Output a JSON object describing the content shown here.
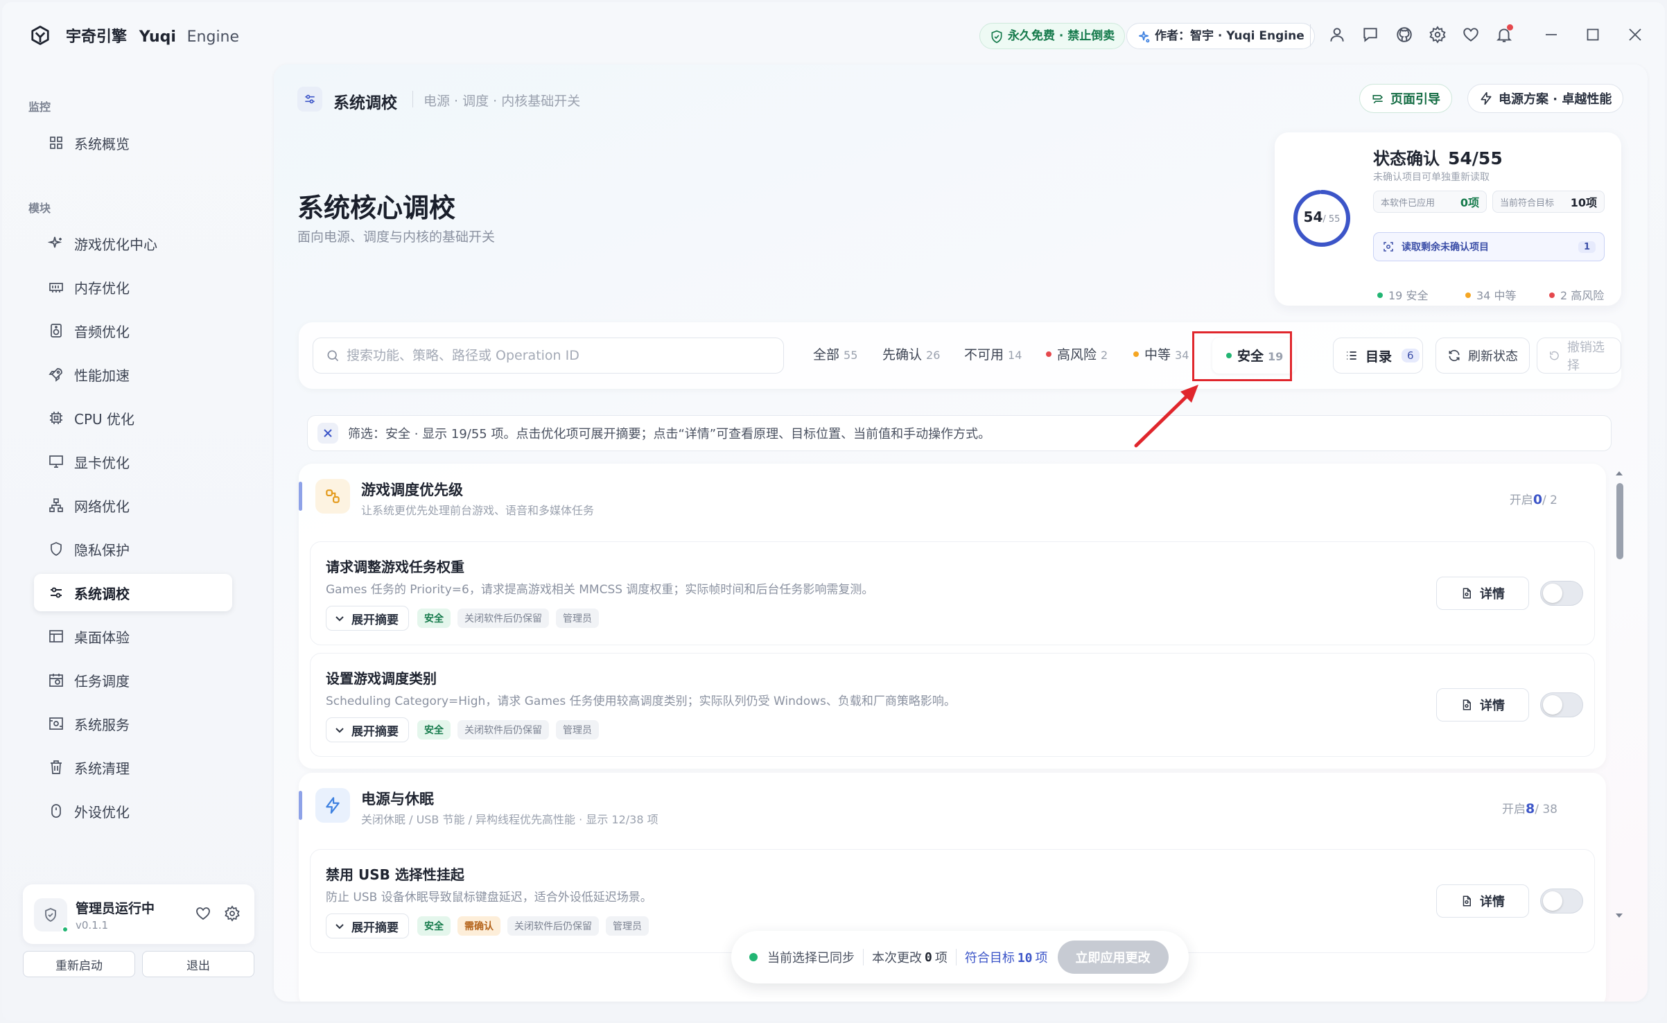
{
  "app": {
    "name": "宇奇引擎",
    "name_en": "Yuqi",
    "name_en2": "Engine"
  },
  "titlebar": {
    "badge_free": "永久免费 · 禁止倒卖",
    "badge_author": "作者：智宇 · Yuqi Engine",
    "icons": [
      "user-icon",
      "chat-icon",
      "github-icon",
      "gear-icon",
      "heart-icon",
      "bell-icon"
    ]
  },
  "sidebar": {
    "section_monitor": "监控",
    "section_modules": "模块",
    "items": [
      {
        "label": "系统概览",
        "icon": "grid-icon"
      },
      {
        "label": "游戏优化中心",
        "icon": "sparkle-icon"
      },
      {
        "label": "内存优化",
        "icon": "memory-icon"
      },
      {
        "label": "音频优化",
        "icon": "speaker-icon"
      },
      {
        "label": "性能加速",
        "icon": "rocket-icon"
      },
      {
        "label": "CPU 优化",
        "icon": "cpu-icon"
      },
      {
        "label": "显卡优化",
        "icon": "monitor-icon"
      },
      {
        "label": "网络优化",
        "icon": "network-icon"
      },
      {
        "label": "隐私保护",
        "icon": "shield-icon"
      },
      {
        "label": "系统调校",
        "icon": "sliders-icon"
      },
      {
        "label": "桌面体验",
        "icon": "layout-icon"
      },
      {
        "label": "任务调度",
        "icon": "calendar-icon"
      },
      {
        "label": "系统服务",
        "icon": "service-icon"
      },
      {
        "label": "系统清理",
        "icon": "trash-icon"
      },
      {
        "label": "外设优化",
        "icon": "mouse-icon"
      }
    ],
    "admin": {
      "title": "管理员运行中",
      "version": "v0.1.1"
    },
    "restart_label": "重新启动",
    "exit_label": "退出"
  },
  "page": {
    "crumb_title": "系统调校",
    "crumb_sub": "电源 · 调度 · 内核基础开关",
    "guide_label": "页面引导",
    "power_label": "电源方案 · 卓越性能",
    "hero_title": "系统核心调校",
    "hero_sub": "面向电源、调度与内核的基础开关"
  },
  "status": {
    "title": "状态确认",
    "confirmed": 54,
    "total": 55,
    "progress_text": "54/55",
    "ring_value": "54",
    "ring_total": "/ 55",
    "hint": "未确认项目可单独重新读取",
    "applied_label": "本软件已应用",
    "applied_value": "0项",
    "target_label": "当前符合目标",
    "target_value": "10项",
    "read_label": "读取剩余未确认项目",
    "read_count": "1",
    "legend_safe": "19 安全",
    "legend_medium": "34 中等",
    "legend_high": "2 高风险",
    "colors": {
      "safe": "#22b573",
      "medium": "#f5a623",
      "high": "#e5484d",
      "ring": "#3c55c8"
    }
  },
  "filter": {
    "search_placeholder": "搜索功能、策略、路径或 Operation ID",
    "tabs": [
      {
        "label": "全部",
        "count": "55"
      },
      {
        "label": "先确认",
        "count": "26"
      },
      {
        "label": "不可用",
        "count": "14"
      },
      {
        "label": "高风险",
        "count": "2"
      },
      {
        "label": "中等",
        "count": "34"
      },
      {
        "label": "安全",
        "count": "19"
      }
    ],
    "toc_label": "目录",
    "toc_count": "6",
    "refresh_label": "刷新状态",
    "undo_label": "撤销选择"
  },
  "notice": "筛选：安全 · 显示 19/55 项。点击优化项可展开摘要；点击“详情”可查看原理、目标位置、当前值和手动操作方式。",
  "groups": [
    {
      "title": "游戏调度优先级",
      "sub": "让系统更优先处理前台游戏、语音和多媒体任务",
      "count_on": "0",
      "count_total": "/ 2",
      "count_prefix": "开启",
      "items": [
        {
          "title": "请求调整游戏任务权重",
          "desc": "Games 任务的 Priority=6，请求提高游戏相关 MMCSS 调度权重；实际帧时间和后台任务影响需复测。",
          "tags": [
            "安全",
            "关闭软件后仍保留",
            "管理员"
          ]
        },
        {
          "title": "设置游戏调度类别",
          "desc": "Scheduling Category=High，请求 Games 任务使用较高调度类别；实际队列仍受 Windows、负载和厂商策略影响。",
          "tags": [
            "安全",
            "关闭软件后仍保留",
            "管理员"
          ]
        }
      ]
    },
    {
      "title": "电源与休眠",
      "sub": "关闭休眠 / USB 节能 / 异构线程优先高性能 · 显示 12/38 项",
      "count_on": "8",
      "count_total": "/ 38",
      "count_prefix": "开启",
      "items": [
        {
          "title": "禁用 USB 选择性挂起",
          "desc": "防止 USB 设备休眠导致鼠标键盘延迟，适合外设低延迟场景。",
          "tags": [
            "安全",
            "需确认",
            "关闭软件后仍保留",
            "管理员"
          ]
        }
      ]
    }
  ],
  "common": {
    "expand_label": "展开摘要",
    "detail_label": "详情"
  },
  "bottom": {
    "synced": "当前选择已同步",
    "change_label": "本次更改",
    "change_value": "0",
    "change_unit": "项",
    "target_label": "符合目标",
    "target_value": "10",
    "target_unit": "项",
    "apply_label": "立即应用更改"
  }
}
